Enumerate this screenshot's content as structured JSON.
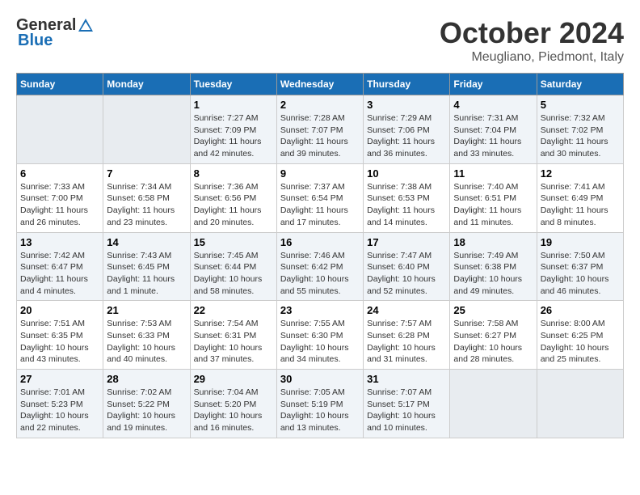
{
  "header": {
    "logo_general": "General",
    "logo_blue": "Blue",
    "title": "October 2024",
    "subtitle": "Meugliano, Piedmont, Italy"
  },
  "weekdays": [
    "Sunday",
    "Monday",
    "Tuesday",
    "Wednesday",
    "Thursday",
    "Friday",
    "Saturday"
  ],
  "weeks": [
    [
      {
        "day": "",
        "empty": true
      },
      {
        "day": "",
        "empty": true
      },
      {
        "day": "1",
        "sunrise": "Sunrise: 7:27 AM",
        "sunset": "Sunset: 7:09 PM",
        "daylight": "Daylight: 11 hours and 42 minutes."
      },
      {
        "day": "2",
        "sunrise": "Sunrise: 7:28 AM",
        "sunset": "Sunset: 7:07 PM",
        "daylight": "Daylight: 11 hours and 39 minutes."
      },
      {
        "day": "3",
        "sunrise": "Sunrise: 7:29 AM",
        "sunset": "Sunset: 7:06 PM",
        "daylight": "Daylight: 11 hours and 36 minutes."
      },
      {
        "day": "4",
        "sunrise": "Sunrise: 7:31 AM",
        "sunset": "Sunset: 7:04 PM",
        "daylight": "Daylight: 11 hours and 33 minutes."
      },
      {
        "day": "5",
        "sunrise": "Sunrise: 7:32 AM",
        "sunset": "Sunset: 7:02 PM",
        "daylight": "Daylight: 11 hours and 30 minutes."
      }
    ],
    [
      {
        "day": "6",
        "sunrise": "Sunrise: 7:33 AM",
        "sunset": "Sunset: 7:00 PM",
        "daylight": "Daylight: 11 hours and 26 minutes."
      },
      {
        "day": "7",
        "sunrise": "Sunrise: 7:34 AM",
        "sunset": "Sunset: 6:58 PM",
        "daylight": "Daylight: 11 hours and 23 minutes."
      },
      {
        "day": "8",
        "sunrise": "Sunrise: 7:36 AM",
        "sunset": "Sunset: 6:56 PM",
        "daylight": "Daylight: 11 hours and 20 minutes."
      },
      {
        "day": "9",
        "sunrise": "Sunrise: 7:37 AM",
        "sunset": "Sunset: 6:54 PM",
        "daylight": "Daylight: 11 hours and 17 minutes."
      },
      {
        "day": "10",
        "sunrise": "Sunrise: 7:38 AM",
        "sunset": "Sunset: 6:53 PM",
        "daylight": "Daylight: 11 hours and 14 minutes."
      },
      {
        "day": "11",
        "sunrise": "Sunrise: 7:40 AM",
        "sunset": "Sunset: 6:51 PM",
        "daylight": "Daylight: 11 hours and 11 minutes."
      },
      {
        "day": "12",
        "sunrise": "Sunrise: 7:41 AM",
        "sunset": "Sunset: 6:49 PM",
        "daylight": "Daylight: 11 hours and 8 minutes."
      }
    ],
    [
      {
        "day": "13",
        "sunrise": "Sunrise: 7:42 AM",
        "sunset": "Sunset: 6:47 PM",
        "daylight": "Daylight: 11 hours and 4 minutes."
      },
      {
        "day": "14",
        "sunrise": "Sunrise: 7:43 AM",
        "sunset": "Sunset: 6:45 PM",
        "daylight": "Daylight: 11 hours and 1 minute."
      },
      {
        "day": "15",
        "sunrise": "Sunrise: 7:45 AM",
        "sunset": "Sunset: 6:44 PM",
        "daylight": "Daylight: 10 hours and 58 minutes."
      },
      {
        "day": "16",
        "sunrise": "Sunrise: 7:46 AM",
        "sunset": "Sunset: 6:42 PM",
        "daylight": "Daylight: 10 hours and 55 minutes."
      },
      {
        "day": "17",
        "sunrise": "Sunrise: 7:47 AM",
        "sunset": "Sunset: 6:40 PM",
        "daylight": "Daylight: 10 hours and 52 minutes."
      },
      {
        "day": "18",
        "sunrise": "Sunrise: 7:49 AM",
        "sunset": "Sunset: 6:38 PM",
        "daylight": "Daylight: 10 hours and 49 minutes."
      },
      {
        "day": "19",
        "sunrise": "Sunrise: 7:50 AM",
        "sunset": "Sunset: 6:37 PM",
        "daylight": "Daylight: 10 hours and 46 minutes."
      }
    ],
    [
      {
        "day": "20",
        "sunrise": "Sunrise: 7:51 AM",
        "sunset": "Sunset: 6:35 PM",
        "daylight": "Daylight: 10 hours and 43 minutes."
      },
      {
        "day": "21",
        "sunrise": "Sunrise: 7:53 AM",
        "sunset": "Sunset: 6:33 PM",
        "daylight": "Daylight: 10 hours and 40 minutes."
      },
      {
        "day": "22",
        "sunrise": "Sunrise: 7:54 AM",
        "sunset": "Sunset: 6:31 PM",
        "daylight": "Daylight: 10 hours and 37 minutes."
      },
      {
        "day": "23",
        "sunrise": "Sunrise: 7:55 AM",
        "sunset": "Sunset: 6:30 PM",
        "daylight": "Daylight: 10 hours and 34 minutes."
      },
      {
        "day": "24",
        "sunrise": "Sunrise: 7:57 AM",
        "sunset": "Sunset: 6:28 PM",
        "daylight": "Daylight: 10 hours and 31 minutes."
      },
      {
        "day": "25",
        "sunrise": "Sunrise: 7:58 AM",
        "sunset": "Sunset: 6:27 PM",
        "daylight": "Daylight: 10 hours and 28 minutes."
      },
      {
        "day": "26",
        "sunrise": "Sunrise: 8:00 AM",
        "sunset": "Sunset: 6:25 PM",
        "daylight": "Daylight: 10 hours and 25 minutes."
      }
    ],
    [
      {
        "day": "27",
        "sunrise": "Sunrise: 7:01 AM",
        "sunset": "Sunset: 5:23 PM",
        "daylight": "Daylight: 10 hours and 22 minutes."
      },
      {
        "day": "28",
        "sunrise": "Sunrise: 7:02 AM",
        "sunset": "Sunset: 5:22 PM",
        "daylight": "Daylight: 10 hours and 19 minutes."
      },
      {
        "day": "29",
        "sunrise": "Sunrise: 7:04 AM",
        "sunset": "Sunset: 5:20 PM",
        "daylight": "Daylight: 10 hours and 16 minutes."
      },
      {
        "day": "30",
        "sunrise": "Sunrise: 7:05 AM",
        "sunset": "Sunset: 5:19 PM",
        "daylight": "Daylight: 10 hours and 13 minutes."
      },
      {
        "day": "31",
        "sunrise": "Sunrise: 7:07 AM",
        "sunset": "Sunset: 5:17 PM",
        "daylight": "Daylight: 10 hours and 10 minutes."
      },
      {
        "day": "",
        "empty": true
      },
      {
        "day": "",
        "empty": true
      }
    ]
  ]
}
